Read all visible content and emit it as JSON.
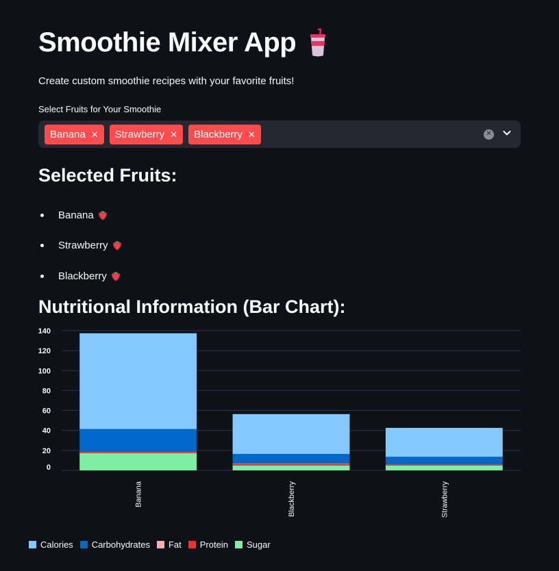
{
  "app": {
    "title": "Smoothie Mixer App",
    "subtitle": "Create custom smoothie recipes with your favorite fruits!"
  },
  "multiselect": {
    "label": "Select Fruits for Your Smoothie",
    "selected": [
      "Banana",
      "Strawberry",
      "Blackberry"
    ],
    "clear_icon": "clear-circle-icon",
    "dropdown_icon": "chevron-down-icon"
  },
  "selected_section": {
    "heading": "Selected Fruits:",
    "items": [
      "Banana",
      "Strawberry",
      "Blackberry"
    ],
    "item_icon": "strawberry-icon"
  },
  "chart_section": {
    "heading": "Nutritional Information (Bar Chart):"
  },
  "chart_data": {
    "type": "bar",
    "stacked": true,
    "categories": [
      "Banana",
      "Blackberry",
      "Strawberry"
    ],
    "series": [
      {
        "name": "Sugar",
        "color": "#7defa1",
        "values": [
          17.2,
          4.9,
          4.9
        ]
      },
      {
        "name": "Protein",
        "color": "#ff2b2b",
        "values": [
          1.1,
          1.4,
          0.7
        ]
      },
      {
        "name": "Fat",
        "color": "#ffabab",
        "values": [
          0.3,
          0.5,
          0.3
        ]
      },
      {
        "name": "Carbohydrates",
        "color": "#0068c9",
        "values": [
          22.8,
          9.6,
          7.7
        ]
      },
      {
        "name": "Calories",
        "color": "#83c9ff",
        "values": [
          96,
          40,
          29
        ]
      }
    ],
    "legend_order": [
      "Calories",
      "Carbohydrates",
      "Fat",
      "Protein",
      "Sugar"
    ],
    "y_ticks": [
      "0",
      "20",
      "40",
      "60",
      "80",
      "100",
      "120",
      "140"
    ],
    "ylim": [
      0,
      140
    ],
    "grid": true,
    "legend_position": "bottom-left"
  }
}
